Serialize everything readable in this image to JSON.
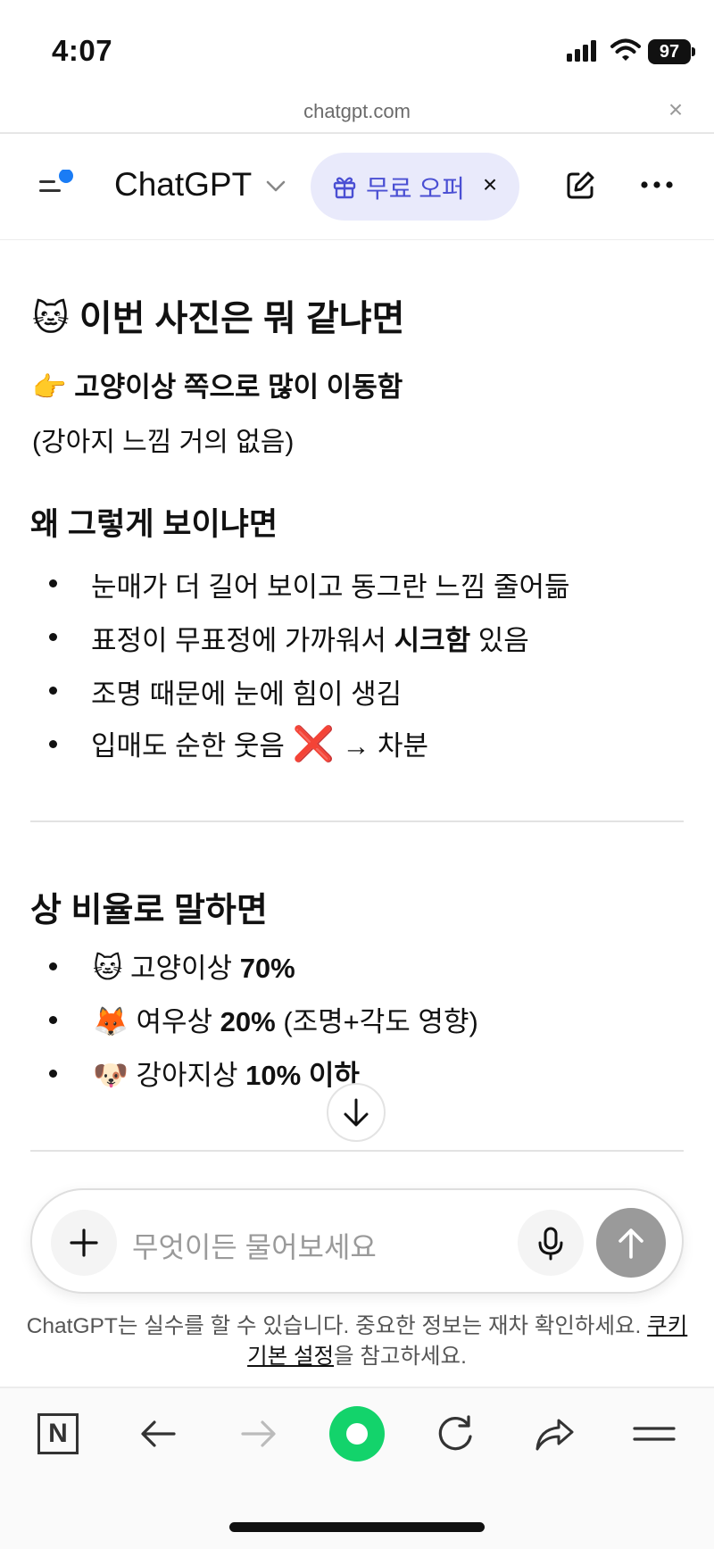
{
  "status_bar": {
    "time": "4:07",
    "battery": "97"
  },
  "url_bar": {
    "domain": "chatgpt.com",
    "close": "×"
  },
  "header": {
    "title": "ChatGPT",
    "offer_label": "무료 오퍼",
    "offer_close": "×"
  },
  "message": {
    "heading_emoji": "🐱",
    "heading": "이번 사진은 뭐 같냐면",
    "verdict_emoji": "👉",
    "verdict": "고양이상 쪽으로 많이 이동함",
    "verdict_note": "(강아지 느낌 거의 없음)",
    "reasons_heading": "왜 그렇게 보이냐면",
    "reasons": [
      {
        "text": "눈매가 더 길어 보이고 동그란 느낌 줄어듦"
      },
      {
        "pre": "표정이 무표정에 가까워서 ",
        "bold": "시크함",
        "post": " 있음"
      },
      {
        "text": "조명 때문에 눈에 힘이 생김"
      },
      {
        "pre": "입매도 순한 웃음 ",
        "mark": "❌",
        "post": " → 차분"
      }
    ],
    "ratio_heading": "상 비율로 말하면",
    "ratios": [
      {
        "emoji": "🐱",
        "label": "고양이상 ",
        "value": "70%",
        "note": ""
      },
      {
        "emoji": "🦊",
        "label": "여우상 ",
        "value": "20%",
        "note": " (조명+각도 영향)"
      },
      {
        "emoji": "🐶",
        "label": "강아지상 ",
        "value": "10% 이하",
        "note": ""
      }
    ]
  },
  "composer": {
    "placeholder": "무엇이든 물어보세요"
  },
  "disclaimer": {
    "text": "ChatGPT는 실수를 할 수 있습니다. 중요한 정보는 재차 확인하세요. ",
    "link": "쿠키 기본 설정",
    "suffix": "을 참고하세요."
  },
  "toolbar": {
    "n_label": "N"
  },
  "colors": {
    "accent": "#4a4fd3",
    "offer_bg": "#e9eafb",
    "menu_dot": "#1a7cf5",
    "green": "#13d36b",
    "send": "#9a9a9a"
  },
  "icons": [
    "menu-icon",
    "chevron-down-icon",
    "gift-icon",
    "compose-icon",
    "more-icon",
    "arrow-down-icon",
    "plus-icon",
    "mic-icon",
    "send-arrow-icon",
    "back-icon",
    "forward-icon",
    "reload-icon",
    "share-icon",
    "tabs-icon"
  ]
}
